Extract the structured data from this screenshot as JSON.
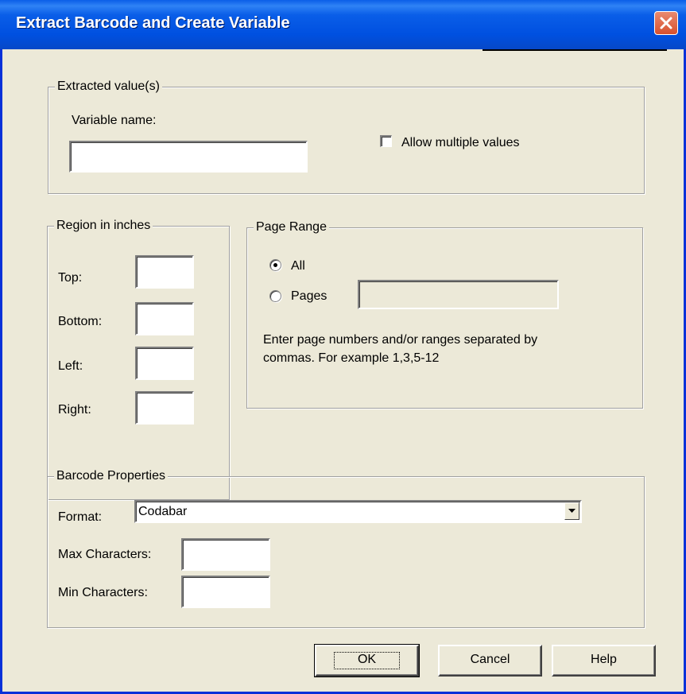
{
  "window": {
    "title": "Extract Barcode and Create Variable",
    "close_icon": "close-icon"
  },
  "extracted": {
    "group_label": "Extracted value(s)",
    "variable_name_label": "Variable name:",
    "variable_name_value": "",
    "allow_multiple_label": "Allow multiple values",
    "allow_multiple_checked": false
  },
  "region": {
    "group_label": "Region in inches",
    "top_label": "Top:",
    "bottom_label": "Bottom:",
    "left_label": "Left:",
    "right_label": "Right:",
    "top_value": "",
    "bottom_value": "",
    "left_value": "",
    "right_value": ""
  },
  "page_range": {
    "group_label": "Page Range",
    "all_label": "All",
    "pages_label": "Pages",
    "selected": "All",
    "pages_value": "",
    "hint_line1": "Enter page numbers and/or ranges separated by",
    "hint_line2": "commas.  For example 1,3,5-12"
  },
  "barcode": {
    "group_label": "Barcode Properties",
    "format_label": "Format:",
    "format_value": "Codabar",
    "max_chars_label": "Max Characters:",
    "min_chars_label": "Min Characters:",
    "max_chars_value": "",
    "min_chars_value": ""
  },
  "buttons": {
    "ok": "OK",
    "cancel": "Cancel",
    "help": "Help"
  },
  "colors": {
    "title_bar": "#0a5ee8",
    "dialog_bg": "#ece9d8",
    "close_button": "#d8502d"
  }
}
